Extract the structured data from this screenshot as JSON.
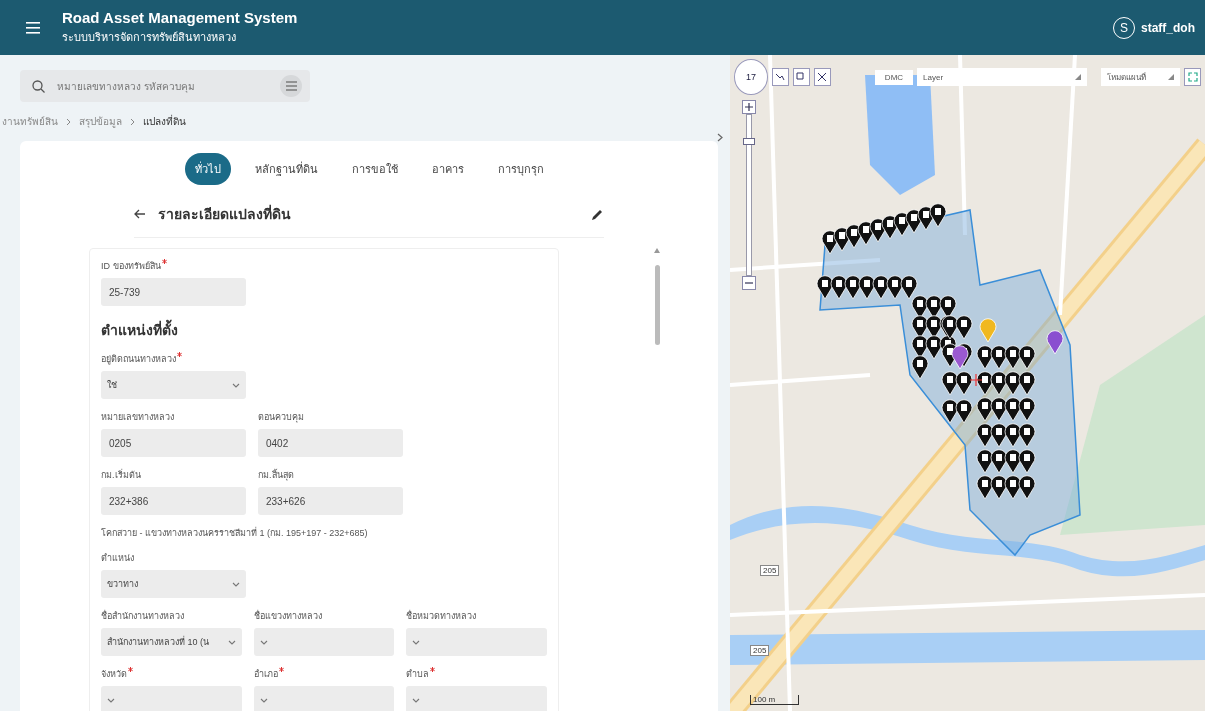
{
  "header": {
    "title": "Road Asset Management System",
    "subtitle": "ระบบบริหารจัดการทรัพย์สินทางหลวง",
    "user_initial": "S",
    "username": "staff_doh"
  },
  "search": {
    "placeholder": "หมายเลขทางหลวง รหัสควบคุม"
  },
  "breadcrumb": [
    "งานทรัพย์สิน",
    "สรุปข้อมูล",
    "แปลงที่ดิน"
  ],
  "tabs": [
    {
      "label": "ทั่วไป",
      "selected": true
    },
    {
      "label": "หลักฐานที่ดิน",
      "selected": false
    },
    {
      "label": "การขอใช้",
      "selected": false
    },
    {
      "label": "อาคาร",
      "selected": false
    },
    {
      "label": "การบุกรุก",
      "selected": false
    }
  ],
  "detail": {
    "title": "รายละเอียดแปลงที่ดิน",
    "rows": [
      {
        "fields": [
          {
            "kind": "text",
            "label": "ID ของทรัพย์สิน",
            "required": true,
            "value": "25-739"
          }
        ]
      },
      {
        "fields": [
          {
            "kind": "heading",
            "label": "ตำแหน่งที่ตั้ง"
          }
        ]
      },
      {
        "fields": [
          {
            "kind": "select",
            "label": "อยู่ติดถนนทางหลวง",
            "required": true,
            "value": "ใช่"
          }
        ]
      },
      {
        "fields": [
          {
            "kind": "text",
            "label": "หมายเลขทางหลวง",
            "required": false,
            "value": "0205"
          },
          {
            "kind": "text",
            "label": "ตอนควบคุม",
            "required": false,
            "value": "0402"
          }
        ]
      },
      {
        "fields": [
          {
            "kind": "text",
            "label": "กม.เริ่มต้น",
            "required": false,
            "value": "232+386"
          },
          {
            "kind": "text",
            "label": "กม.สิ้นสุด",
            "required": false,
            "value": "233+626"
          }
        ]
      },
      {
        "fields": [
          {
            "kind": "note",
            "label": "โคกสวาย - แขวงทางหลวงนครราชสีมาที่ 1 (กม. 195+197 - 232+685)"
          }
        ]
      },
      {
        "fields": [
          {
            "kind": "select",
            "label": "ตำแหน่ง",
            "required": false,
            "value": "ขวาทาง"
          }
        ]
      },
      {
        "fields": [
          {
            "kind": "select",
            "label": "ชื่อสำนักงานทางหลวง",
            "required": false,
            "value": "สำนักงานทางหลวงที่ 10 (น"
          },
          {
            "kind": "select",
            "label": "ชื่อแขวงทางหลวง",
            "required": false
          },
          {
            "kind": "select",
            "label": "ชื่อหมวดทางหลวง",
            "required": false
          }
        ]
      },
      {
        "fields": [
          {
            "kind": "select",
            "label": "จังหวัด",
            "required": true
          },
          {
            "kind": "select",
            "label": "อำเภอ",
            "required": true
          },
          {
            "kind": "select",
            "label": "ตำบล",
            "required": true
          }
        ]
      }
    ]
  },
  "map": {
    "zoom_level": "17",
    "source": "DMC",
    "layer_select": "Layer",
    "basemap_select": "โหมดแผนที่",
    "zoom_slider": {
      "level": 0.85
    },
    "road_shields": [
      "205",
      "205"
    ],
    "scale": "100 m"
  }
}
